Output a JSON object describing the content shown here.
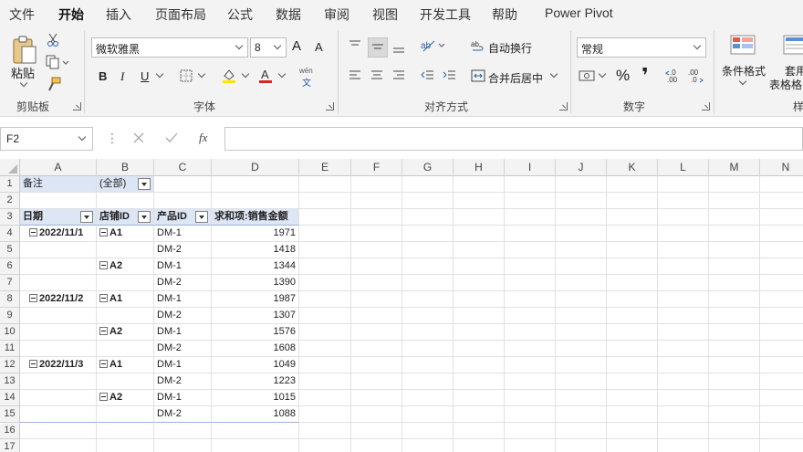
{
  "menu_tabs": [
    "文件",
    "开始",
    "插入",
    "页面布局",
    "公式",
    "数据",
    "审阅",
    "视图",
    "开发工具",
    "帮助",
    "Power Pivot"
  ],
  "active_tab": "开始",
  "ribbon": {
    "clipboard": {
      "paste_label": "粘贴",
      "group_label": "剪贴板"
    },
    "font": {
      "font_name": "微软雅黑",
      "font_size": "8",
      "group_label": "字体",
      "bold": "B",
      "italic": "I",
      "underline": "U",
      "grow": "A",
      "shrink": "A",
      "phonetic": "wén",
      "phonetic2": "文"
    },
    "alignment": {
      "wrap_text": "自动换行",
      "merge_center": "合并后居中",
      "group_label": "对齐方式"
    },
    "number": {
      "format": "常规",
      "group_label": "数字",
      "percent": "%",
      "comma": "❜"
    },
    "styles": {
      "conditional_format": "条件格式",
      "table_format_1": "套用",
      "table_format_2": "表格格",
      "group_label_partial": "样"
    }
  },
  "formula_bar": {
    "name_box": "F2",
    "fx": "fx",
    "formula": ""
  },
  "columns": [
    "A",
    "B",
    "C",
    "D",
    "E",
    "F",
    "G",
    "H",
    "I",
    "J",
    "K",
    "L",
    "M",
    "N"
  ],
  "rows": [
    "1",
    "2",
    "3",
    "4",
    "5",
    "6",
    "7",
    "8",
    "9",
    "10",
    "11",
    "12",
    "13",
    "14",
    "15",
    "16",
    "17"
  ],
  "pivot": {
    "filter_label": "备注",
    "filter_value": "(全部)",
    "headers": [
      "日期",
      "店铺ID",
      "产品ID",
      "求和项:销售金额"
    ],
    "data": [
      {
        "date": "2022/11/1",
        "store": "A1",
        "product": "DM-1",
        "amount": "1971"
      },
      {
        "date": "",
        "store": "",
        "product": "DM-2",
        "amount": "1418"
      },
      {
        "date": "",
        "store": "A2",
        "product": "DM-1",
        "amount": "1344"
      },
      {
        "date": "",
        "store": "",
        "product": "DM-2",
        "amount": "1390"
      },
      {
        "date": "2022/11/2",
        "store": "A1",
        "product": "DM-1",
        "amount": "1987"
      },
      {
        "date": "",
        "store": "",
        "product": "DM-2",
        "amount": "1307"
      },
      {
        "date": "",
        "store": "A2",
        "product": "DM-1",
        "amount": "1576"
      },
      {
        "date": "",
        "store": "",
        "product": "DM-2",
        "amount": "1608"
      },
      {
        "date": "2022/11/3",
        "store": "A1",
        "product": "DM-1",
        "amount": "1049"
      },
      {
        "date": "",
        "store": "",
        "product": "DM-2",
        "amount": "1223"
      },
      {
        "date": "",
        "store": "A2",
        "product": "DM-1",
        "amount": "1015"
      },
      {
        "date": "",
        "store": "",
        "product": "DM-2",
        "amount": "1088"
      }
    ]
  },
  "colors": {
    "accent": "#217346",
    "pivot_header": "#dde6f4"
  }
}
